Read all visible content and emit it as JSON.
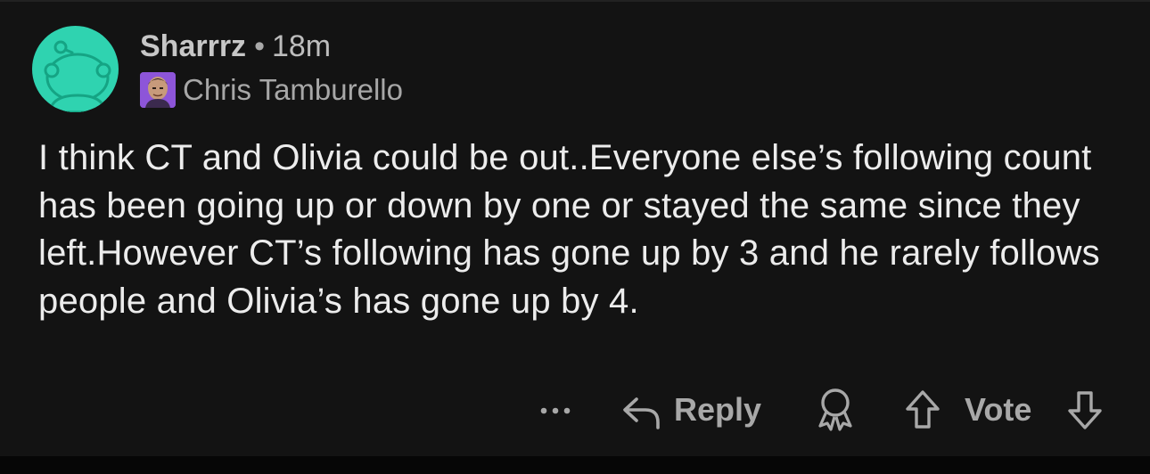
{
  "comment": {
    "username": "Sharrrz",
    "separator": "•",
    "time_ago": "18m",
    "flair": {
      "text": "Chris Tamburello",
      "image_icon": "person-photo-icon"
    },
    "avatar_icon": "snoo-avatar-icon",
    "body": "I think CT and Olivia could be out..Everyone else’s following count has been going up or down by one or stayed the same since they left.However CT’s following has gone up by 3 and he rarely follows people and Olivia’s has gone up by 4."
  },
  "actions": {
    "more_icon": "more-options-icon",
    "reply_icon": "reply-arrow-icon",
    "reply_label": "Reply",
    "award_icon": "award-icon",
    "upvote_icon": "upvote-arrow-icon",
    "vote_label": "Vote",
    "downvote_icon": "downvote-arrow-icon"
  },
  "colors": {
    "background": "#131313",
    "avatar": "#2fd3b0",
    "text_primary": "#ececec",
    "text_secondary": "#a8a8a8"
  }
}
